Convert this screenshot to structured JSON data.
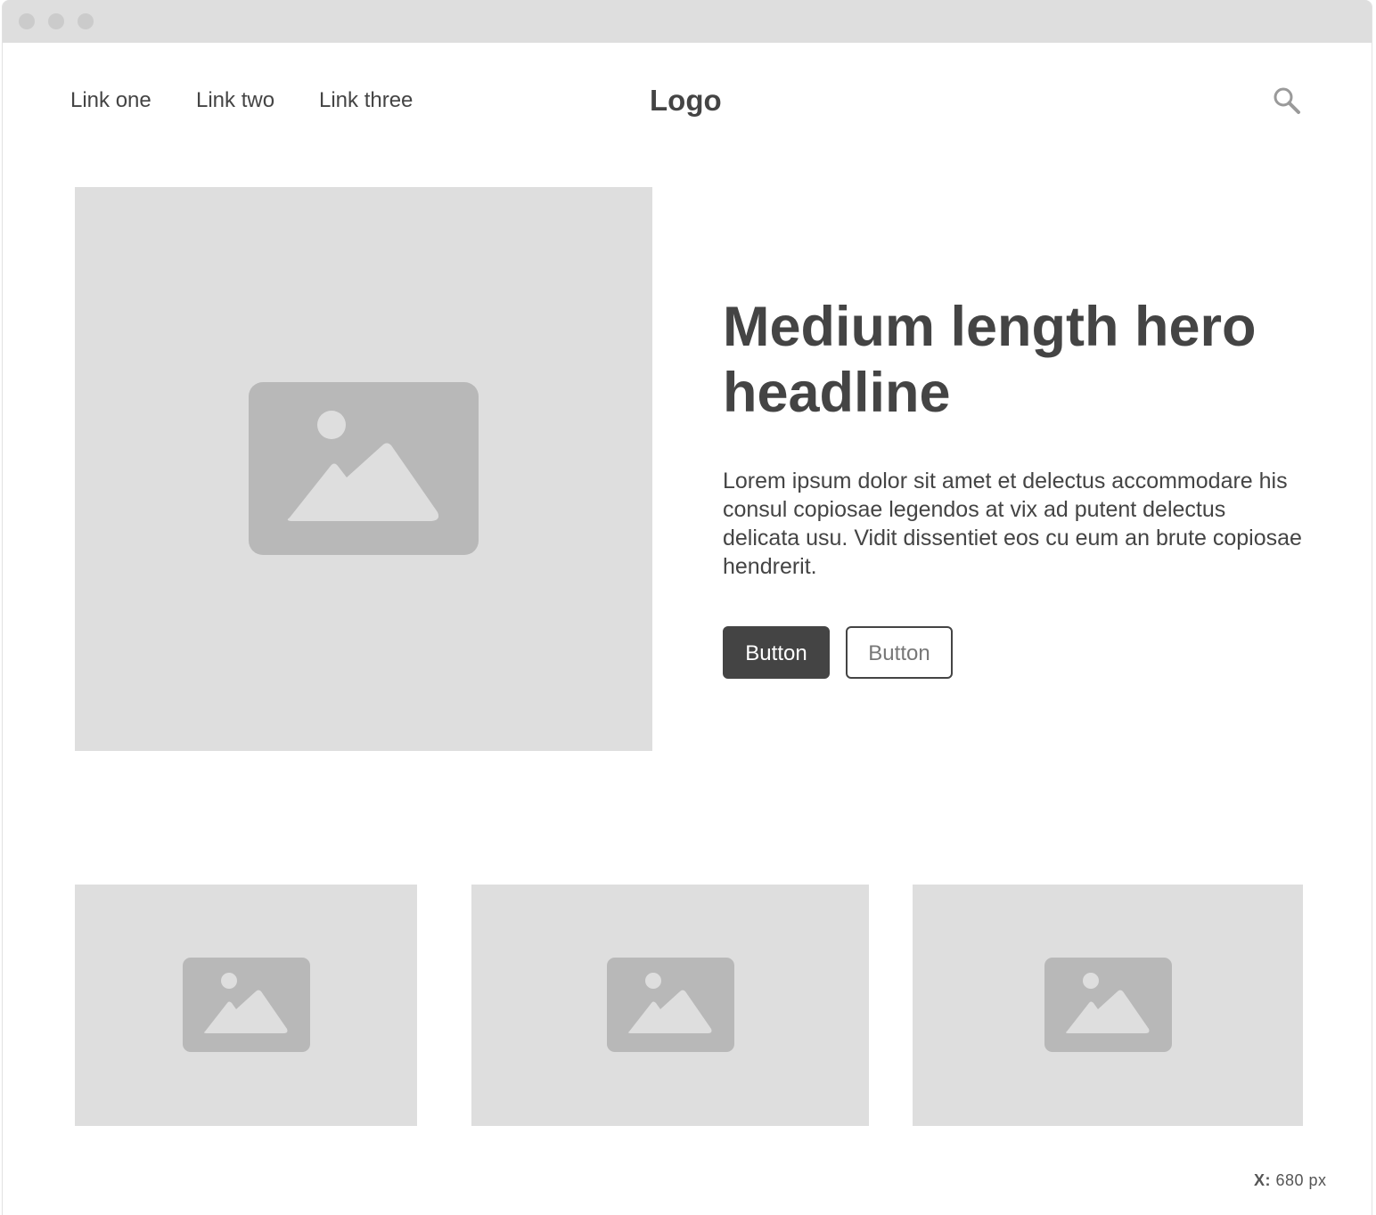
{
  "nav": {
    "links": [
      "Link one",
      "Link two",
      "Link three"
    ],
    "logo": "Logo",
    "search_icon": "search-icon"
  },
  "hero": {
    "image_icon": "image-placeholder-icon",
    "headline": "Medium length hero headline",
    "body": "Lorem ipsum dolor sit amet et delectus accommodare his consul copiosae legendos at vix ad putent delectus delicata usu. Vidit dissentiet eos cu eum an brute copiosae hendrerit.",
    "primary_button": "Button",
    "secondary_button": "Button"
  },
  "cards": [
    {
      "icon": "image-placeholder-icon"
    },
    {
      "icon": "image-placeholder-icon"
    },
    {
      "icon": "image-placeholder-icon"
    }
  ],
  "status": {
    "coord_label": "X:",
    "coord_value": "680 px"
  },
  "colors": {
    "text": "#444444",
    "placeholder_bg": "#dedede",
    "placeholder_icon": "#b8b8b8",
    "titlebar": "#dedede"
  }
}
